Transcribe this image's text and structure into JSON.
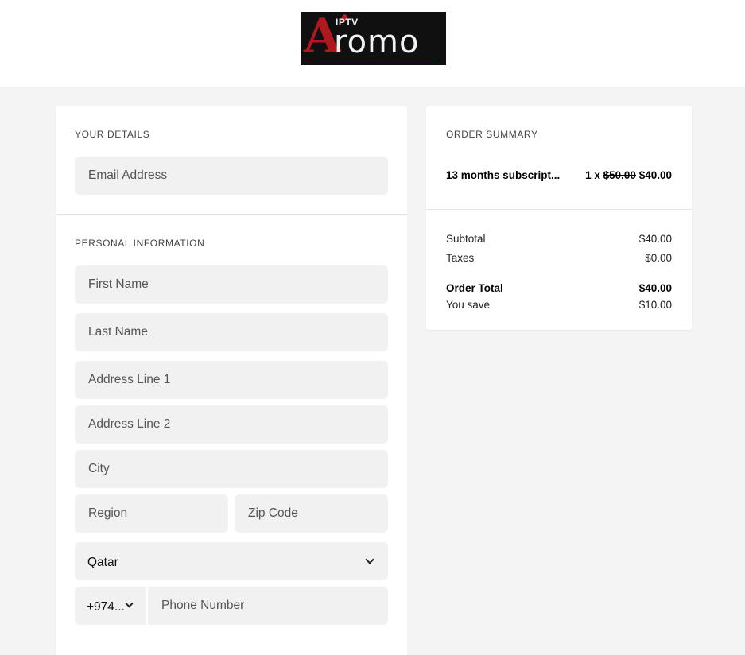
{
  "brand": {
    "logo_letter": "A",
    "logo_small": "IPTV",
    "logo_text": "romo"
  },
  "details": {
    "section_title": "YOUR DETAILS",
    "email_placeholder": "Email Address"
  },
  "personal": {
    "section_title": "PERSONAL INFORMATION",
    "first_name_placeholder": "First Name",
    "last_name_placeholder": "Last Name",
    "address1_placeholder": "Address Line 1",
    "address2_placeholder": "Address Line 2",
    "city_placeholder": "City",
    "region_placeholder": "Region",
    "zip_placeholder": "Zip Code",
    "country_value": "Qatar",
    "phone_code_value": "+974...",
    "phone_placeholder": "Phone Number"
  },
  "summary": {
    "section_title": "ORDER SUMMARY",
    "item_name": "13 months subscript...",
    "item_qty": "1 x",
    "item_old_price": "$50.00",
    "item_price": "$40.00",
    "subtotal_label": "Subtotal",
    "subtotal_value": "$40.00",
    "taxes_label": "Taxes",
    "taxes_value": "$0.00",
    "total_label": "Order Total",
    "total_value": "$40.00",
    "save_label": "You save",
    "save_value": "$10.00"
  }
}
